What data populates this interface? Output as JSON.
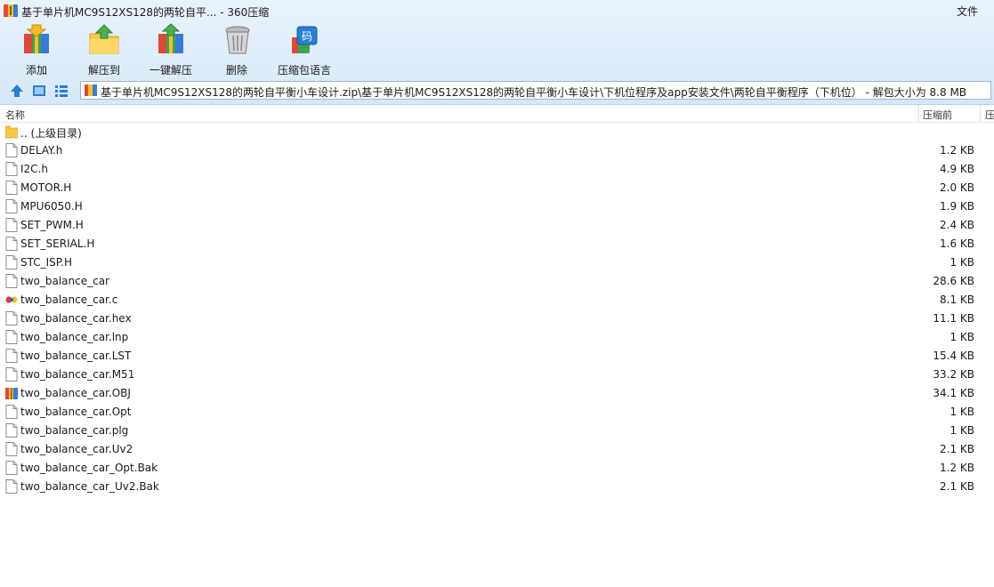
{
  "window": {
    "title": "基于单片机MC9S12XS128的两轮自平... - 360压缩",
    "menu_file": "文件"
  },
  "toolbar": {
    "items": [
      {
        "label": "添加",
        "icon": "add-icon"
      },
      {
        "label": "解压到",
        "icon": "extract-to-icon"
      },
      {
        "label": "一键解压",
        "icon": "one-click-extract-icon"
      },
      {
        "label": "删除",
        "icon": "delete-icon"
      },
      {
        "label": "压缩包语言",
        "icon": "archive-encoding-icon"
      }
    ]
  },
  "addressbar": {
    "path": "基于单片机MC9S12XS128的两轮自平衡小车设计.zip\\基于单片机MC9S12XS128的两轮自平衡小车设计\\下机位程序及app安装文件\\两轮自平衡程序（下机位） - 解包大小为 8.8 MB"
  },
  "columns": {
    "name": "名称",
    "compressed": "压缩前",
    "extra": "压"
  },
  "colors": {
    "chrome_top": "#e9f3fc",
    "chrome_bottom": "#d7e8f8",
    "accent": "#2a7fd4",
    "folder": "#f7c948"
  },
  "files": [
    {
      "name": ".. (上级目录)",
      "size": "",
      "type": "folder"
    },
    {
      "name": "DELAY.h",
      "size": "1.2 KB",
      "type": "file"
    },
    {
      "name": "I2C.h",
      "size": "4.9 KB",
      "type": "file"
    },
    {
      "name": "MOTOR.H",
      "size": "2.0 KB",
      "type": "file"
    },
    {
      "name": "MPU6050.H",
      "size": "1.9 KB",
      "type": "file"
    },
    {
      "name": "SET_PWM.H",
      "size": "2.4 KB",
      "type": "file"
    },
    {
      "name": "SET_SERIAL.H",
      "size": "1.6 KB",
      "type": "file"
    },
    {
      "name": "STC_ISP.H",
      "size": "1 KB",
      "type": "file"
    },
    {
      "name": "two_balance_car",
      "size": "28.6 KB",
      "type": "file"
    },
    {
      "name": "two_balance_car.c",
      "size": "8.1 KB",
      "type": "c-source"
    },
    {
      "name": "two_balance_car.hex",
      "size": "11.1 KB",
      "type": "file"
    },
    {
      "name": "two_balance_car.lnp",
      "size": "1 KB",
      "type": "file"
    },
    {
      "name": "two_balance_car.LST",
      "size": "15.4 KB",
      "type": "file"
    },
    {
      "name": "two_balance_car.M51",
      "size": "33.2 KB",
      "type": "file"
    },
    {
      "name": "two_balance_car.OBJ",
      "size": "34.1 KB",
      "type": "archive"
    },
    {
      "name": "two_balance_car.Opt",
      "size": "1 KB",
      "type": "file"
    },
    {
      "name": "two_balance_car.plg",
      "size": "1 KB",
      "type": "file"
    },
    {
      "name": "two_balance_car.Uv2",
      "size": "2.1 KB",
      "type": "file"
    },
    {
      "name": "two_balance_car_Opt.Bak",
      "size": "1.2 KB",
      "type": "file"
    },
    {
      "name": "two_balance_car_Uv2.Bak",
      "size": "2.1 KB",
      "type": "file"
    }
  ]
}
